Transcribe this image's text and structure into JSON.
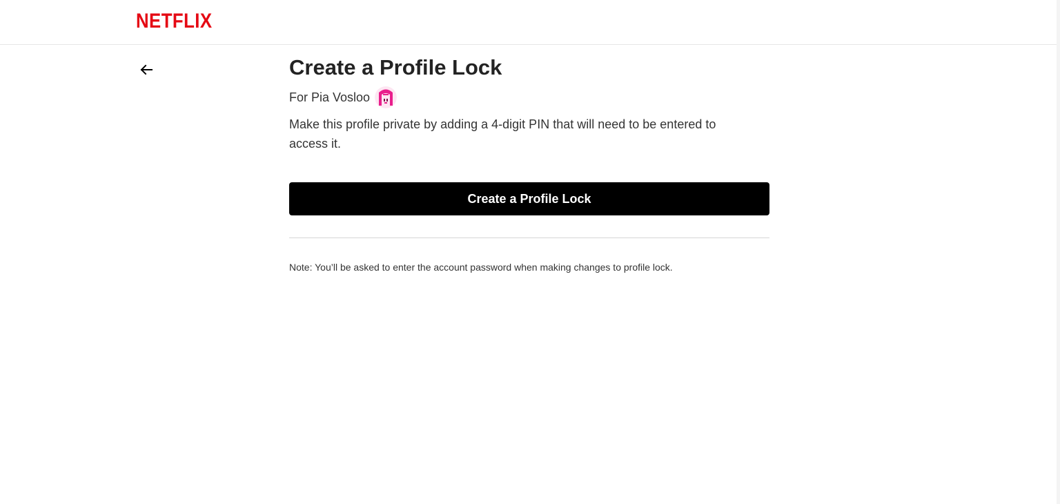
{
  "header": {
    "logo_text": "NETFLIX",
    "logo_color": "#e50914"
  },
  "nav": {
    "back_icon": "arrow-left-icon"
  },
  "main": {
    "title": "Create a Profile Lock",
    "profile_label": "For Pia Vosloo",
    "avatar_icon": "profile-avatar-icon",
    "description": "Make this profile private by adding a 4-digit PIN that will need to be entered to access it.",
    "button_label": "Create a Profile Lock",
    "note": "Note: You’ll be asked to enter the account password when making changes to profile lock."
  },
  "colors": {
    "button_bg": "#000000",
    "button_text": "#ffffff",
    "text": "#333333",
    "avatar": "#e91e8c"
  }
}
